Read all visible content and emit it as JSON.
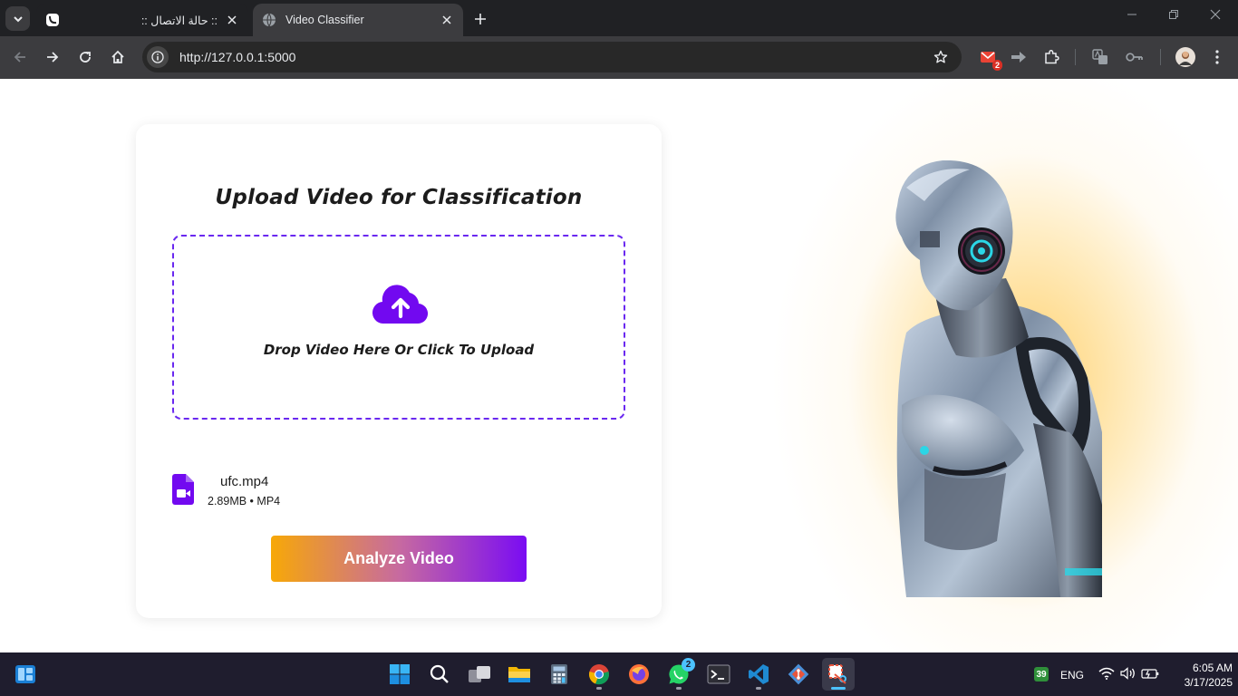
{
  "browser": {
    "tabs": [
      {
        "title": ":: حالة الاتصال ::",
        "active": false
      },
      {
        "title": "Video Classifier",
        "active": true
      }
    ],
    "url": "http://127.0.0.1:5000",
    "extensions": [
      {
        "name": "gmail-extension",
        "badge": "2"
      },
      {
        "name": "forward-extension"
      },
      {
        "name": "puzzle-extensions"
      },
      {
        "name": "translate-extension"
      },
      {
        "name": "password-key-extension"
      }
    ]
  },
  "upload": {
    "title": "Upload Video for Classification",
    "drop_text": "Drop Video Here Or Click To Upload"
  },
  "file": {
    "name": "ufc.mp4",
    "meta": "2.89MB • MP4"
  },
  "actions": {
    "analyze_label": "Analyze Video"
  },
  "colors": {
    "accent_purple": "#6a28f0",
    "button_gradient_start": "#f7a807",
    "button_gradient_end": "#7a0cf3",
    "glow": "#ffc13c"
  },
  "taskbar": {
    "apps": [
      {
        "name": "start-icon"
      },
      {
        "name": "search-icon"
      },
      {
        "name": "task-view-icon"
      },
      {
        "name": "file-explorer-icon"
      },
      {
        "name": "calculator-icon"
      },
      {
        "name": "chrome-icon"
      },
      {
        "name": "firefox-icon"
      },
      {
        "name": "whatsapp-icon",
        "badge": "2"
      },
      {
        "name": "terminal-icon"
      },
      {
        "name": "vscode-icon"
      },
      {
        "name": "git-icon"
      },
      {
        "name": "snipping-tool-icon"
      }
    ],
    "tray": {
      "weather_badge": "39",
      "language": "ENG",
      "time": "6:05 AM",
      "date": "3/17/2025"
    }
  }
}
